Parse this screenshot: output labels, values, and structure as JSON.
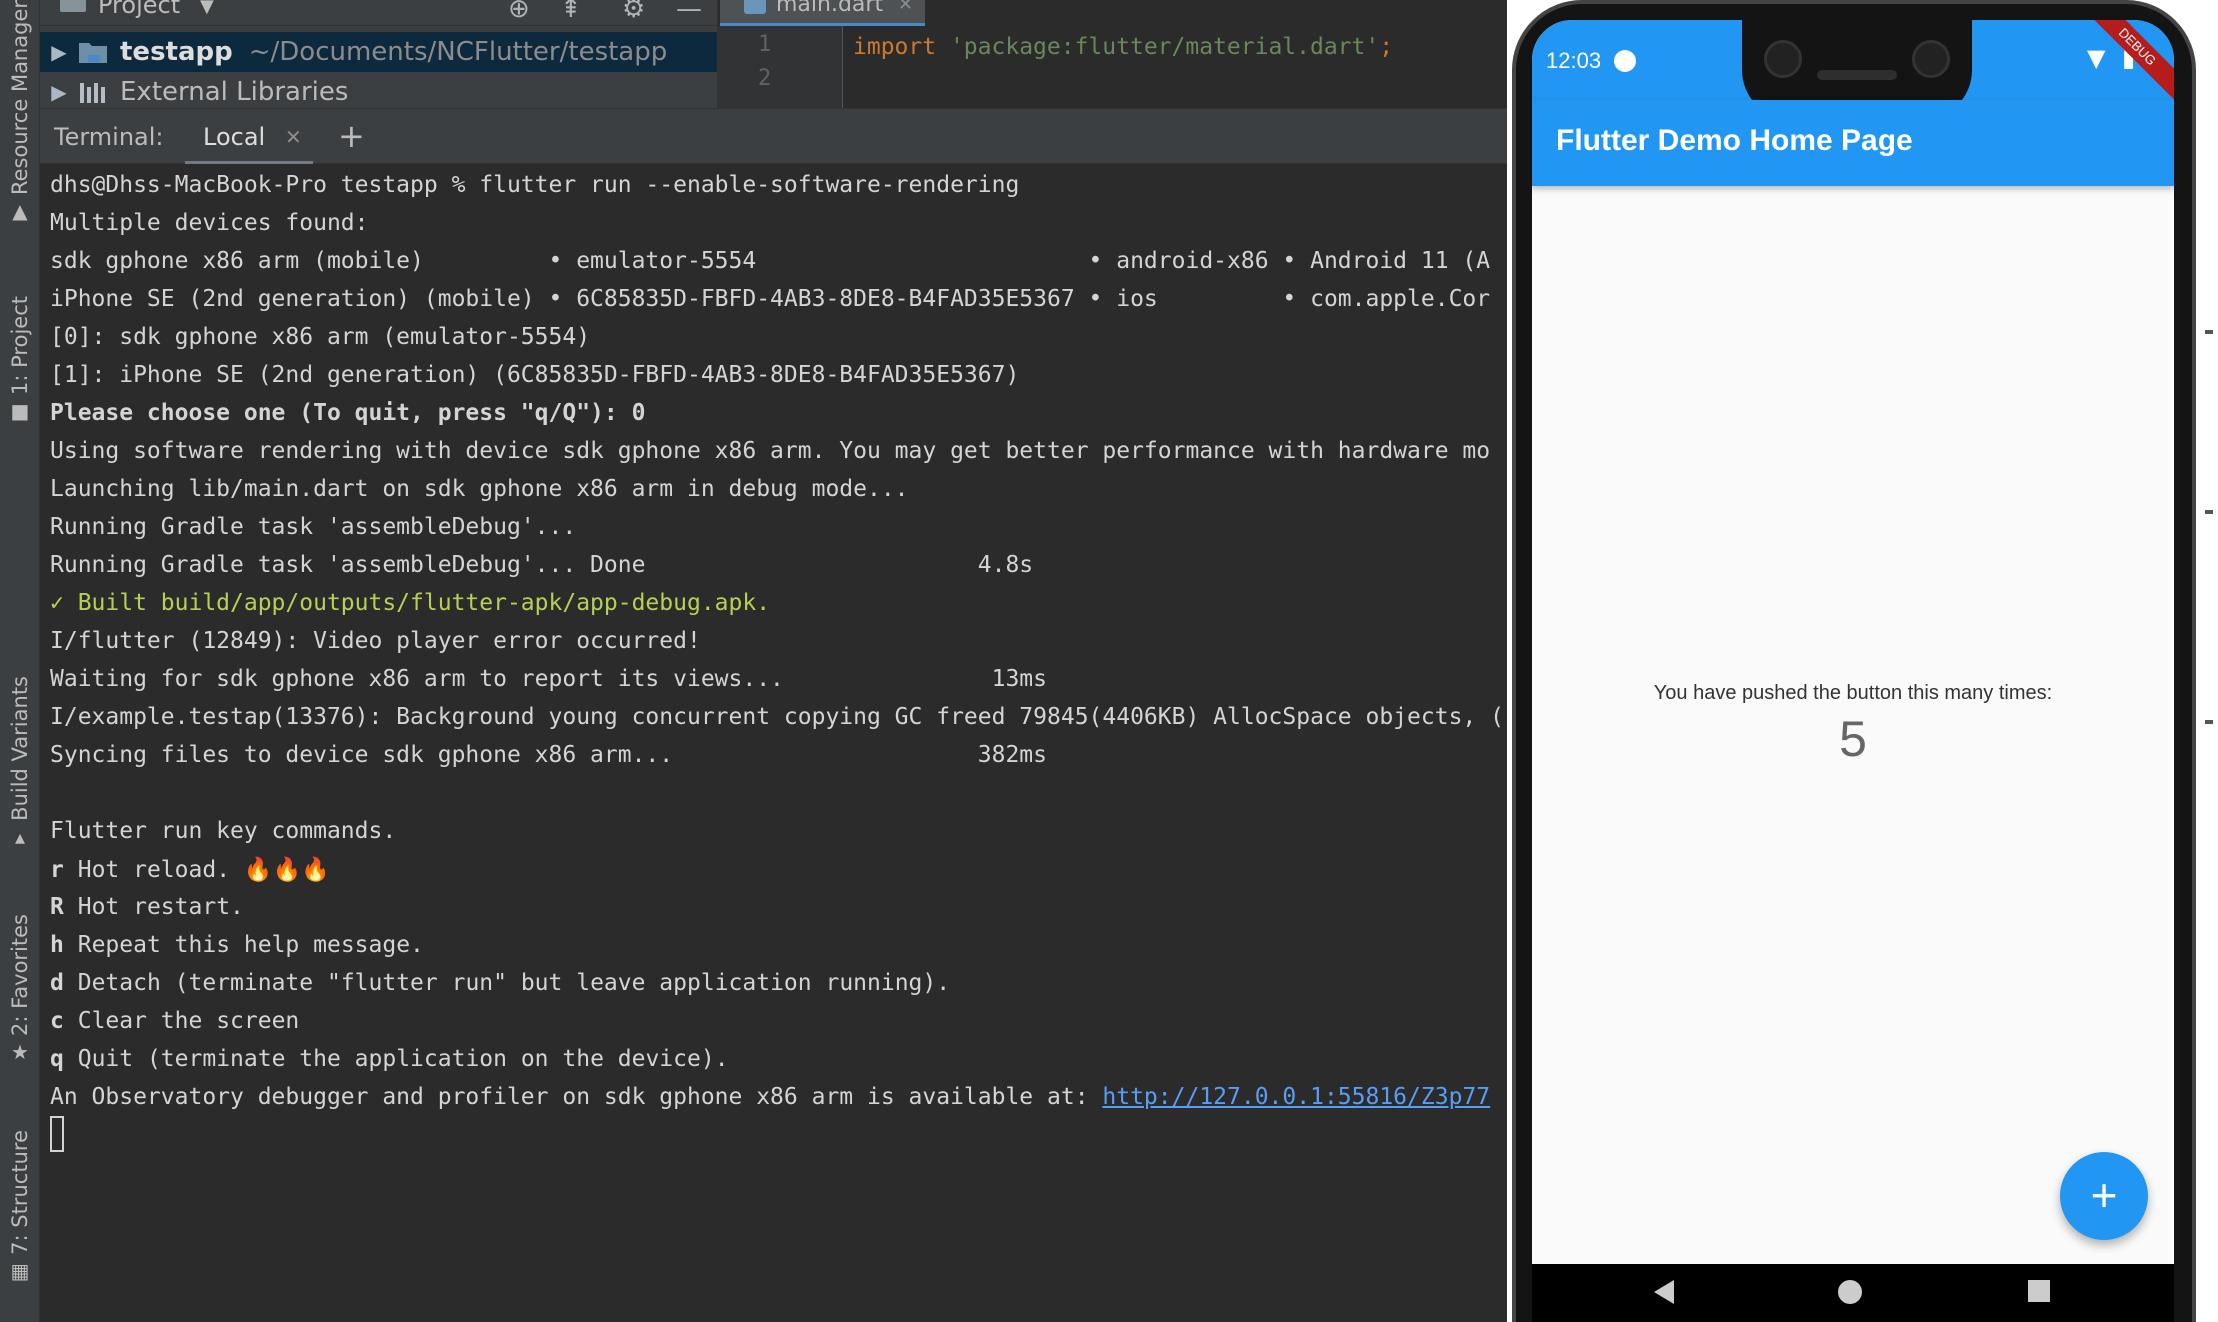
{
  "left_strip": {
    "tabs": [
      {
        "label": "Resource Manager",
        "icon": "resource-manager-icon"
      },
      {
        "label": "1: Project",
        "icon": "folder-icon"
      },
      {
        "label": "Build Variants",
        "icon": "build-variants-icon"
      },
      {
        "label": "2: Favorites",
        "icon": "star-icon"
      },
      {
        "label": "7: Structure",
        "icon": "structure-icon"
      }
    ]
  },
  "project": {
    "title": "Project",
    "tree": [
      {
        "name": "testapp",
        "path": "~/Documents/NCFlutter/testapp"
      },
      {
        "name": "External Libraries"
      }
    ]
  },
  "editor": {
    "tab": "main.dart",
    "line_numbers": [
      "1",
      "2"
    ],
    "code": {
      "keyword": "import",
      "string": "'package:flutter/material.dart'",
      "semicolon": ";"
    }
  },
  "terminal": {
    "title": "Terminal:",
    "tab": "Local",
    "add": "+",
    "lines": [
      "dhs@Dhss-MacBook-Pro testapp % flutter run --enable-software-rendering",
      "Multiple devices found:",
      "sdk gphone x86 arm (mobile)         • emulator-5554                        • android-x86 • Android 11 (A",
      "iPhone SE (2nd generation) (mobile) • 6C85835D-FBFD-4AB3-8DE8-B4FAD35E5367 • ios         • com.apple.Cor",
      "[0]: sdk gphone x86 arm (emulator-5554)",
      "[1]: iPhone SE (2nd generation) (6C85835D-FBFD-4AB3-8DE8-B4FAD35E5367)",
      "Please choose one (To quit, press \"q/Q\"): 0",
      "Using software rendering with device sdk gphone x86 arm. You may get better performance with hardware mo",
      "Launching lib/main.dart on sdk gphone x86 arm in debug mode...",
      "Running Gradle task 'assembleDebug'...",
      "Running Gradle task 'assembleDebug'... Done                        4.8s",
      "✓ Built build/app/outputs/flutter-apk/app-debug.apk.",
      "I/flutter (12849): Video player error occurred!",
      "Waiting for sdk gphone x86 arm to report its views...               13ms",
      "I/example.testap(13376): Background young concurrent copying GC freed 79845(4406KB) AllocSpace objects, (",
      "Syncing files to device sdk gphone x86 arm...                      382ms",
      "",
      "Flutter run key commands.",
      "Hot reload. 🔥🔥🔥",
      "Hot restart.",
      "Repeat this help message.",
      "Detach (terminate \"flutter run\" but leave application running).",
      "Clear the screen",
      "Quit (terminate the application on the device).",
      "An Observatory debugger and profiler on sdk gphone x86 arm is available at: "
    ],
    "keys": [
      "r",
      "R",
      "h",
      "d",
      "c",
      "q"
    ],
    "observatory_url": "http://127.0.0.1:55816/Z3p77"
  },
  "phone": {
    "status_time": "12:03",
    "debug_banner": "DEBUG",
    "app_title": "Flutter Demo Home Page",
    "counter_label": "You have pushed the button this many times:",
    "counter_value": "5",
    "fab_label": "+"
  },
  "colors": {
    "flutter_blue": "#2196f3",
    "terminal_bg": "#2b2b2b",
    "panel_bg": "#3c3f41",
    "success_green": "#b5d155",
    "link_blue": "#589df6"
  }
}
